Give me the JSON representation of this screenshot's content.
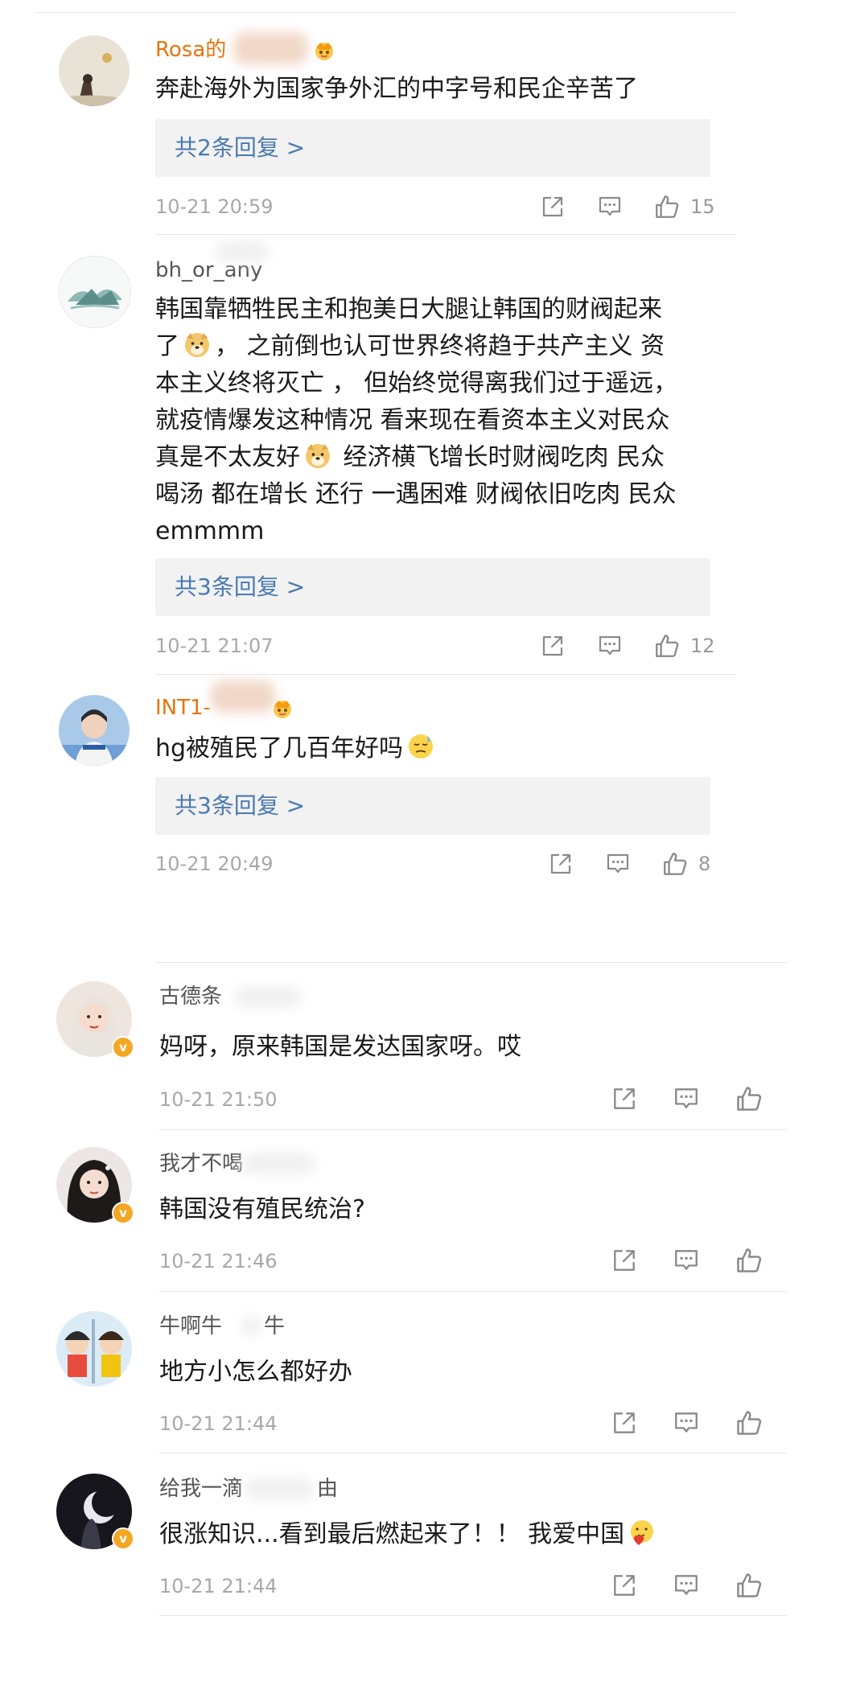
{
  "comments": [
    {
      "username": "Rosa的",
      "text": [
        "奔赴海外为国家争外汇的中字号和民企辛苦了"
      ],
      "reply_label": "共2条回复 >",
      "time": "10-21 20:59",
      "likes": "15"
    },
    {
      "username": "bh_or_any",
      "text": [
        "韩国靠牺牲民主和抱美日大腿让韩国的财阀起来",
        "了[doge]， 之前倒也认可世界终将趋于共产主义 资",
        "本主义终将灭亡 ， 但始终觉得离我们过于遥远，",
        "就疫情爆发这种情况 看来现在看资本主义对民众",
        "真是不太友好[doge] 经济横飞增长时财阀吃肉 民众",
        "喝汤 都在增长 还行 一遇困难 财阀依旧吃肉 民众",
        "emmmm"
      ],
      "reply_label": "共3条回复 >",
      "time": "10-21 21:07",
      "likes": "12"
    },
    {
      "username": "INT1-",
      "text": [
        "hg被殖民了几百年好吗[sweat]"
      ],
      "reply_label": "共3条回复 >",
      "time": "10-21 20:49",
      "likes": "8"
    },
    {
      "username": "古德条",
      "text": [
        "妈呀，原来韩国是发达国家呀。哎"
      ],
      "time": "10-21 21:50",
      "verified": true
    },
    {
      "username": "我才不喝",
      "text": [
        "韩国没有殖民统治?"
      ],
      "time": "10-21 21:46",
      "verified": true
    },
    {
      "username": "牛啊牛",
      "text": [
        "地方小怎么都好办"
      ],
      "time": "10-21 21:44"
    },
    {
      "username": "给我一滴",
      "text": [
        "很涨知识...看到最后燃起来了！！ 我爱中国[heart]"
      ],
      "time": "10-21 21:44",
      "verified": true
    }
  ],
  "icons": {
    "share": "share-icon",
    "comment": "comment-icon",
    "like": "thumbs-up-icon",
    "verified": "verified-badge-icon",
    "crown": "vip-crown-icon"
  },
  "colors": {
    "username_highlight": "#e8740c",
    "reply_link": "#4a7ab0",
    "verified_badge": "#f5a623"
  },
  "labels": {
    "verified_glyph": "v",
    "suffix_a": "牛",
    "suffix_b": "由"
  }
}
